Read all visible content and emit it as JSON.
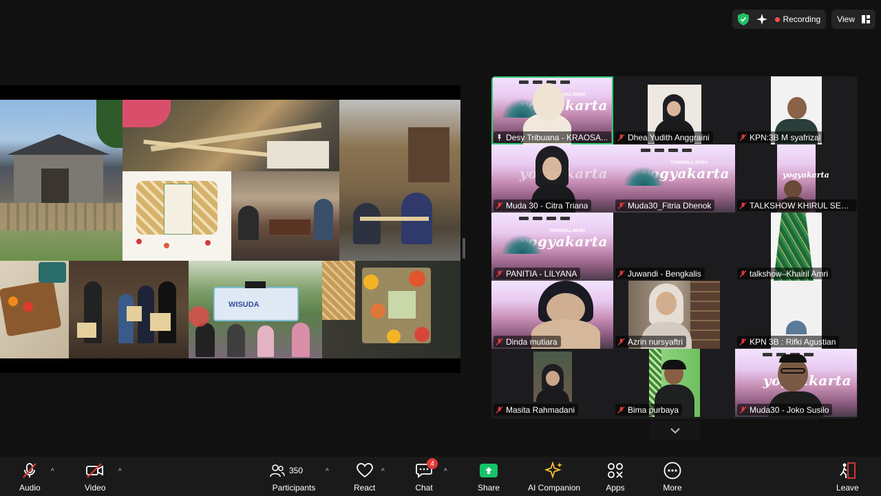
{
  "topbar": {
    "recording_label": "Recording",
    "view_label": "View"
  },
  "gallery": {
    "tiles": [
      {
        "name": "Desy Tribuana - KRAOSA..."
      },
      {
        "name": "Dhea Yudith Anggraini"
      },
      {
        "name": "KPN:3B M syafrizal"
      },
      {
        "name": "Muda 30 - Citra Triana"
      },
      {
        "name": "Muda30_Fitria Dhenok"
      },
      {
        "name": "TALKSHOW KHIRUL SETIA..."
      },
      {
        "name": "PANITIA - LILYANA"
      },
      {
        "name": "Juwandi - Bengkalis"
      },
      {
        "name": "talkshow–Khairil Amri"
      },
      {
        "name": "Dinda mutiara"
      },
      {
        "name": "Azrin nursyaftri"
      },
      {
        "name": "KPN 3B : Rifki Agustian"
      },
      {
        "name": "Masita Rahmadani"
      },
      {
        "name": "Bima purbaya"
      },
      {
        "name": "Muda30 - Joko Susilo"
      }
    ],
    "background_text": "yogyakarta",
    "background_small": "TOWNHALL MUDA"
  },
  "shared_screen": {
    "graduation_banner": "WISUDA"
  },
  "toolbar": {
    "audio_label": "Audio",
    "video_label": "Video",
    "participants_label": "Participants",
    "participants_count": "350",
    "react_label": "React",
    "chat_label": "Chat",
    "chat_badge": "4",
    "share_label": "Share",
    "ai_label": "AI Companion",
    "apps_label": "Apps",
    "more_label": "More",
    "leave_label": "Leave"
  },
  "colors": {
    "accent_green": "#17c26a",
    "active_border": "#2ecc71",
    "recording_dot": "#ff4b4b",
    "mute_red": "#e03a3a"
  }
}
